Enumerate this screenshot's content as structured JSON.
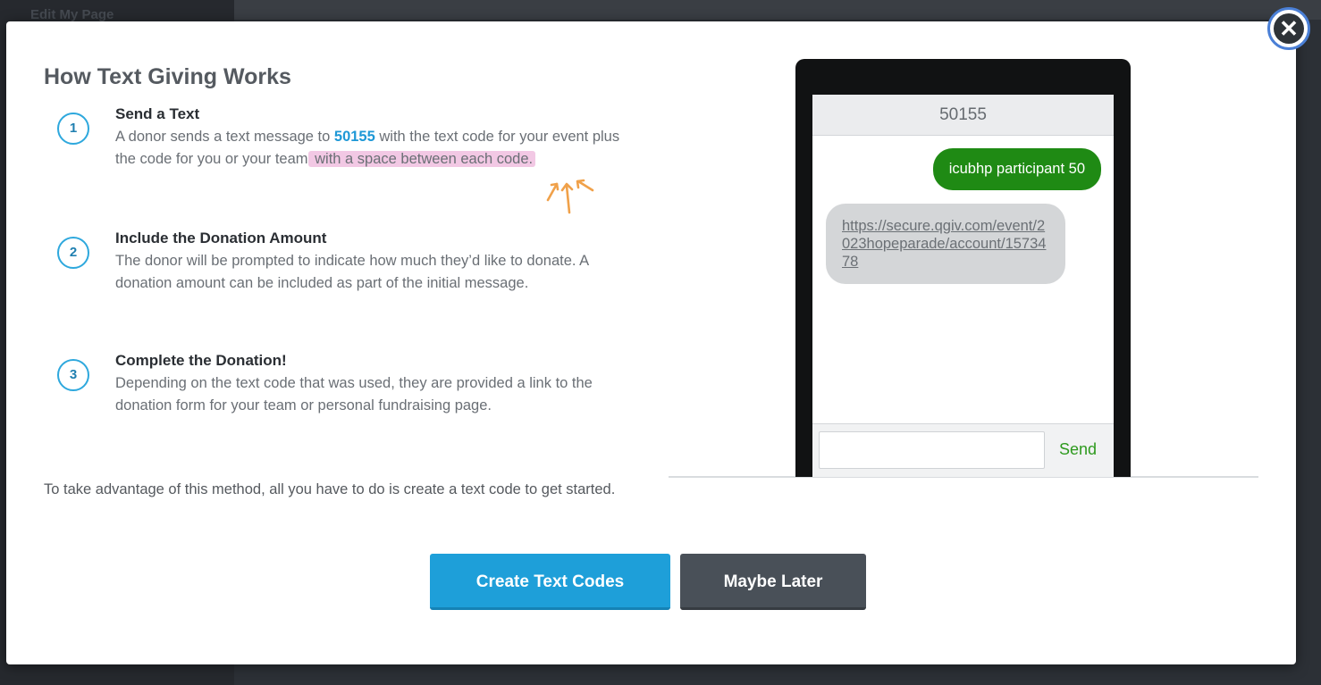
{
  "backdrop": {
    "label": "Edit My Page"
  },
  "modal": {
    "title": "How Text Giving Works",
    "close_icon": "✕",
    "steps": [
      {
        "number": "1",
        "title": "Send a Text",
        "desc_part1": "A donor sends a text message to ",
        "code": "50155",
        "desc_part2": " with the text code for your event plus the code for you or your team",
        "desc_highlight": " with a space between each code."
      },
      {
        "number": "2",
        "title": "Include the Donation Amount",
        "desc": "The donor will be prompted to indicate how much they’d like to donate. A donation amount can be included as part of the initial message."
      },
      {
        "number": "3",
        "title": "Complete the Donation!",
        "desc": "Depending on the text code that was used, they are provided a link to the donation form for your team or personal fundraising page."
      }
    ],
    "footnote": "To take advantage of this method, all you have to do is create a text code to get started.",
    "buttons": {
      "create": "Create Text Codes",
      "later": "Maybe Later"
    },
    "phone": {
      "header": "50155",
      "outgoing": "icubhp participant 50",
      "incoming_link": "https://secure.qgiv.com/event/2023hopeparade/account/1573478",
      "send_label": "Send"
    }
  },
  "colors": {
    "accent": "#1e9fd9",
    "sent_bubble": "#1f8a14",
    "highlight": "#f2c8e4",
    "annotation_arrows": "#f0a14a"
  }
}
